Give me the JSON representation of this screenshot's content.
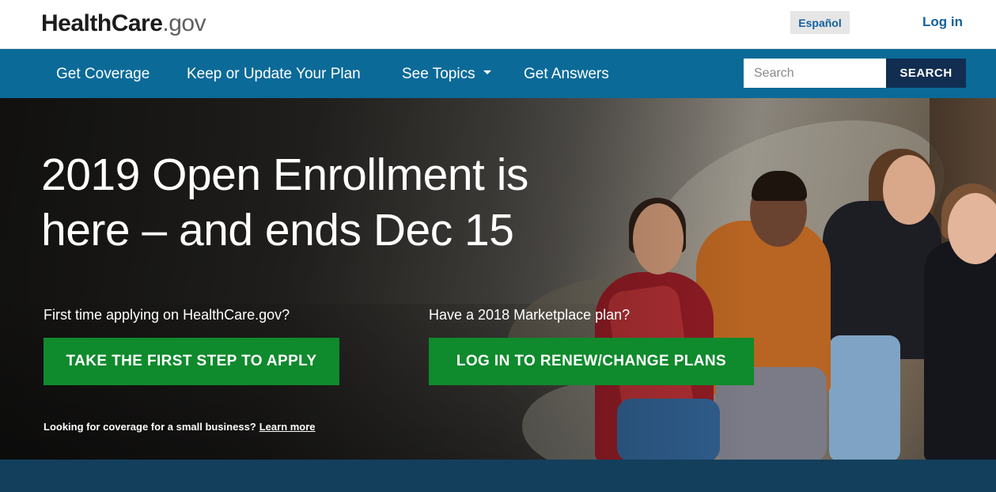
{
  "header": {
    "logo": {
      "part1": "Health",
      "part2": "Care",
      "part3": ".gov"
    },
    "language_toggle": "Español",
    "login_link": "Log in"
  },
  "nav": {
    "items": [
      {
        "label": "Get Coverage"
      },
      {
        "label": "Keep or Update Your Plan"
      },
      {
        "label": "See Topics"
      },
      {
        "label": "Get Answers"
      }
    ],
    "search_placeholder": "Search",
    "search_button": "SEARCH"
  },
  "hero": {
    "headline_line1": "2019 Open Enrollment is",
    "headline_line2": "here – and ends Dec 15",
    "left_prompt": "First time applying on HealthCare.gov?",
    "right_prompt": "Have a 2018 Marketplace plan?",
    "apply_button": "TAKE THE FIRST STEP TO APPLY",
    "renew_button": "LOG IN TO RENEW/CHANGE PLANS",
    "small_business_text": "Looking for coverage for a small business?",
    "learn_more": "Learn more"
  },
  "colors": {
    "nav_background": "#0b6a98",
    "search_button": "#112e51",
    "cta_green": "#0f8a2c",
    "link_blue": "#1261a0",
    "footer_band": "#133f5c"
  }
}
